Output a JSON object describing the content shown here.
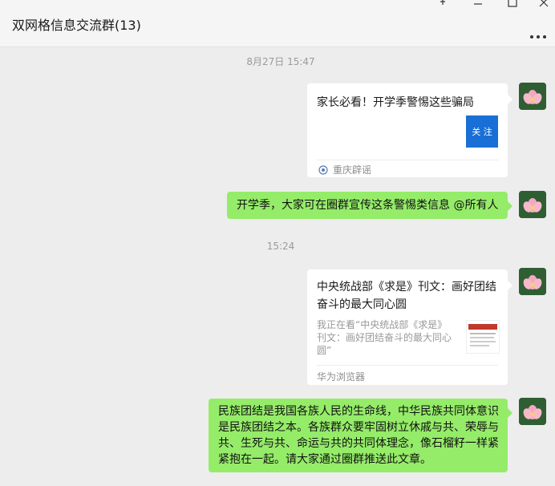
{
  "window": {
    "title": "双网格信息交流群(13)"
  },
  "messages": [
    {
      "type": "timestamp",
      "text": "8月27日 15:47"
    },
    {
      "type": "link_card",
      "title": "家长必看！开学季警惕这些骗局",
      "thumb_text": "关 注",
      "source": "重庆辟谣"
    },
    {
      "type": "text",
      "text": "开学季，大家可在圈群宣传这条警惕类信息 @所有人"
    },
    {
      "type": "timestamp",
      "text": "15:24"
    },
    {
      "type": "link_card",
      "title_line1": "中央统战部《求是》刊文：画好团结",
      "title_line2": "奋斗的最大同心圆",
      "desc_line1": "我正在看“中央统战部《求是》",
      "desc_line2": "刊文：画好团结奋斗的最大同心",
      "desc_line3": "圆”",
      "source": "华为浏览器"
    },
    {
      "type": "text",
      "lines": [
        "民族团结是我国各族人民的生命线，中华民族共同体意识",
        "是民族团结之本。各族群众要牢固树立休戚与共、荣辱与",
        "共、生死与共、命运与共的共同体理念，像石榴籽一样紧",
        "紧抱在一起。请大家通过圈群推送此文章。"
      ]
    }
  ],
  "colors": {
    "background": "#ededed",
    "bubble_self": "#95ec69",
    "card": "#ffffff",
    "thumb_blue": "#1a6fd6"
  },
  "icons": [
    "pin-icon",
    "minimize-icon",
    "maximize-icon",
    "close-icon",
    "more-icon",
    "lotus-avatar",
    "source-logo-icon"
  ]
}
